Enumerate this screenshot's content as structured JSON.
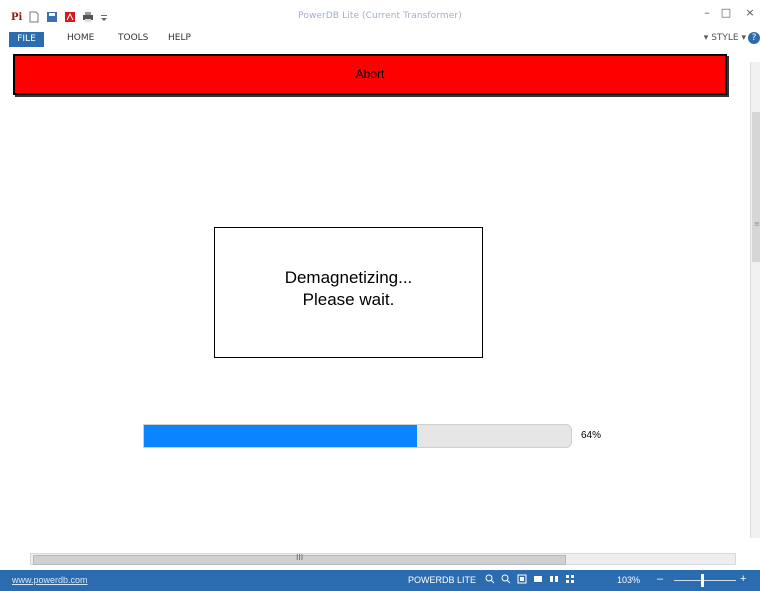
{
  "window": {
    "title": "PowerDB Lite (Current Transformer)",
    "controls": {
      "minimize": "–",
      "maximize": "□",
      "close": "×"
    }
  },
  "quick_access": [
    "app-logo-icon",
    "new-file-icon",
    "save-icon",
    "pdf-icon",
    "print-icon",
    "customize-dropdown-icon"
  ],
  "menu": {
    "items": [
      "FILE",
      "HOME",
      "TOOLS",
      "HELP"
    ],
    "style": "STYLE",
    "help_icon": "?"
  },
  "main": {
    "abort_label": "Abort",
    "message_line1": "Demagnetizing...",
    "message_line2": "Please wait.",
    "progress_value": 64,
    "progress_text": "64%",
    "hscroll_grip": "III"
  },
  "status": {
    "link": "www.powerdb.com",
    "app": "POWERDB LITE",
    "zoom": "103%",
    "zoom_minus": "–",
    "zoom_plus": "+"
  },
  "colors": {
    "accent": "#2b6cb0",
    "abort": "#ff0000",
    "progress": "#0a84ff"
  }
}
